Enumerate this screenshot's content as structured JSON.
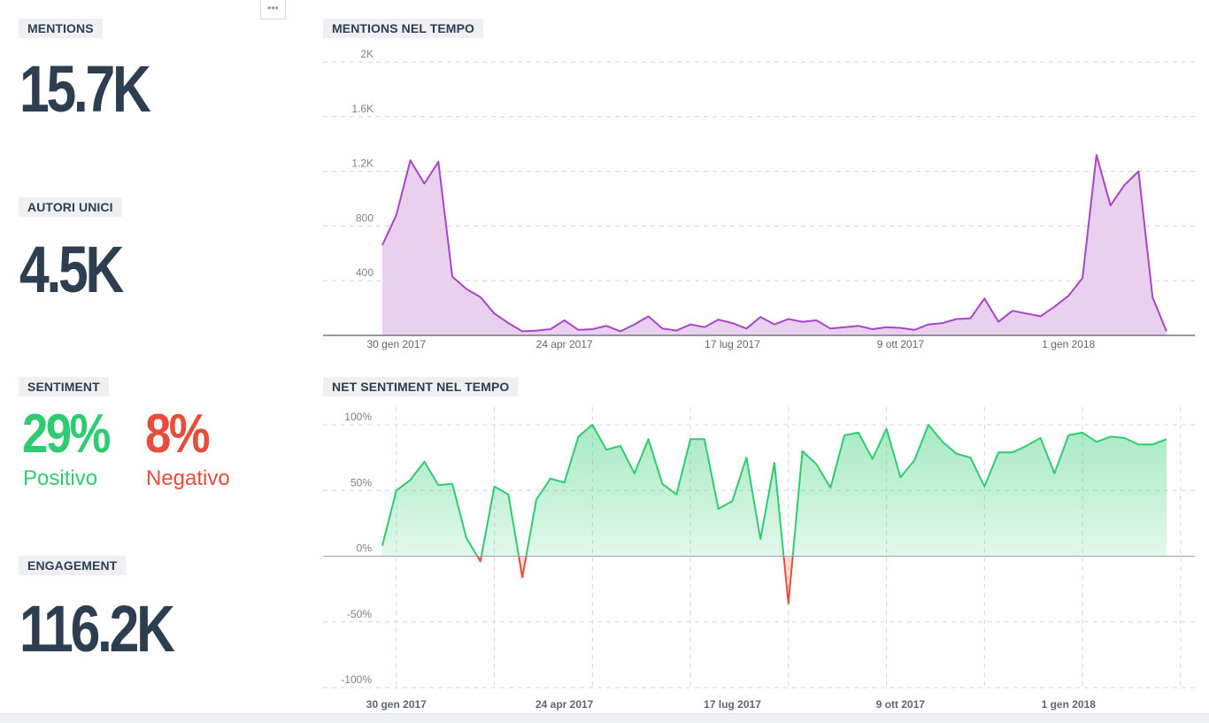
{
  "menu": {
    "icon": "more-horizontal-icon",
    "label": "•••"
  },
  "kpis": {
    "mentions": {
      "label": "MENTIONS",
      "value": "15.7K"
    },
    "authors": {
      "label": "AUTORI UNICI",
      "value": "4.5K"
    },
    "sentiment": {
      "label": "SENTIMENT",
      "positive_value": "29%",
      "positive_label": "Positivo",
      "negative_value": "8%",
      "negative_label": "Negativo"
    },
    "engagement": {
      "label": "ENGAGEMENT",
      "value": "116.2K"
    }
  },
  "colors": {
    "positive": "#2ecc71",
    "negative": "#e74c3c",
    "mentions_line": "#a845c9",
    "mentions_fill": "#e9d0ee",
    "heading": "#2d3e50"
  },
  "chart_data": [
    {
      "type": "area",
      "title": "MENTIONS NEL TEMPO",
      "x_start": "2017-01-23",
      "x_step_days": 7,
      "x_ticks": [
        {
          "label": "30 gen 2017",
          "x": "2017-01-30"
        },
        {
          "label": "24 apr 2017",
          "x": "2017-04-24"
        },
        {
          "label": "17 lug 2017",
          "x": "2017-07-17"
        },
        {
          "label": "9 ott 2017",
          "x": "2017-10-09"
        },
        {
          "label": "1 gen 2018",
          "x": "2018-01-01"
        }
      ],
      "y_ticks": [
        {
          "label": "400",
          "v": 400
        },
        {
          "label": "800",
          "v": 800
        },
        {
          "label": "1.2K",
          "v": 1200
        },
        {
          "label": "1.6K",
          "v": 1600
        },
        {
          "label": "2K",
          "v": 2000
        }
      ],
      "ylim": [
        0,
        2000
      ],
      "values": [
        660,
        880,
        1280,
        1110,
        1270,
        430,
        340,
        280,
        160,
        90,
        30,
        35,
        45,
        110,
        40,
        45,
        70,
        30,
        80,
        140,
        50,
        35,
        80,
        60,
        115,
        90,
        50,
        135,
        80,
        120,
        100,
        110,
        50,
        60,
        70,
        45,
        60,
        55,
        40,
        80,
        90,
        120,
        125,
        270,
        100,
        180,
        160,
        140,
        210,
        290,
        420,
        1320,
        950,
        1100,
        1200,
        280,
        30
      ],
      "grid": true
    },
    {
      "type": "area",
      "title": "NET SENTIMENT NEL TEMPO",
      "x_start": "2017-01-23",
      "x_step_days": 7,
      "x_ticks": [
        {
          "label": "30 gen 2017",
          "x": "2017-01-30"
        },
        {
          "label": "24 apr 2017",
          "x": "2017-04-24"
        },
        {
          "label": "17 lug 2017",
          "x": "2017-07-17"
        },
        {
          "label": "9 ott 2017",
          "x": "2017-10-09"
        },
        {
          "label": "1 gen 2018",
          "x": "2018-01-01"
        }
      ],
      "y_ticks": [
        {
          "label": "-100%",
          "v": -100
        },
        {
          "label": "-50%",
          "v": -50
        },
        {
          "label": "0%",
          "v": 0
        },
        {
          "label": "50%",
          "v": 50
        },
        {
          "label": "100%",
          "v": 100
        }
      ],
      "ylim": [
        -100,
        100
      ],
      "values": [
        8,
        50,
        58,
        72,
        54,
        55,
        14,
        -4,
        53,
        47,
        -16,
        43,
        59,
        56,
        91,
        100,
        81,
        84,
        63,
        89,
        55,
        47,
        89,
        89,
        36,
        42,
        75,
        13,
        71,
        -36,
        80,
        70,
        52,
        92,
        94,
        74,
        97,
        60,
        73,
        100,
        87,
        78,
        75,
        53,
        79,
        79,
        84,
        90,
        63,
        92,
        94,
        87,
        91,
        90,
        85,
        85,
        89
      ],
      "grid": true
    }
  ]
}
